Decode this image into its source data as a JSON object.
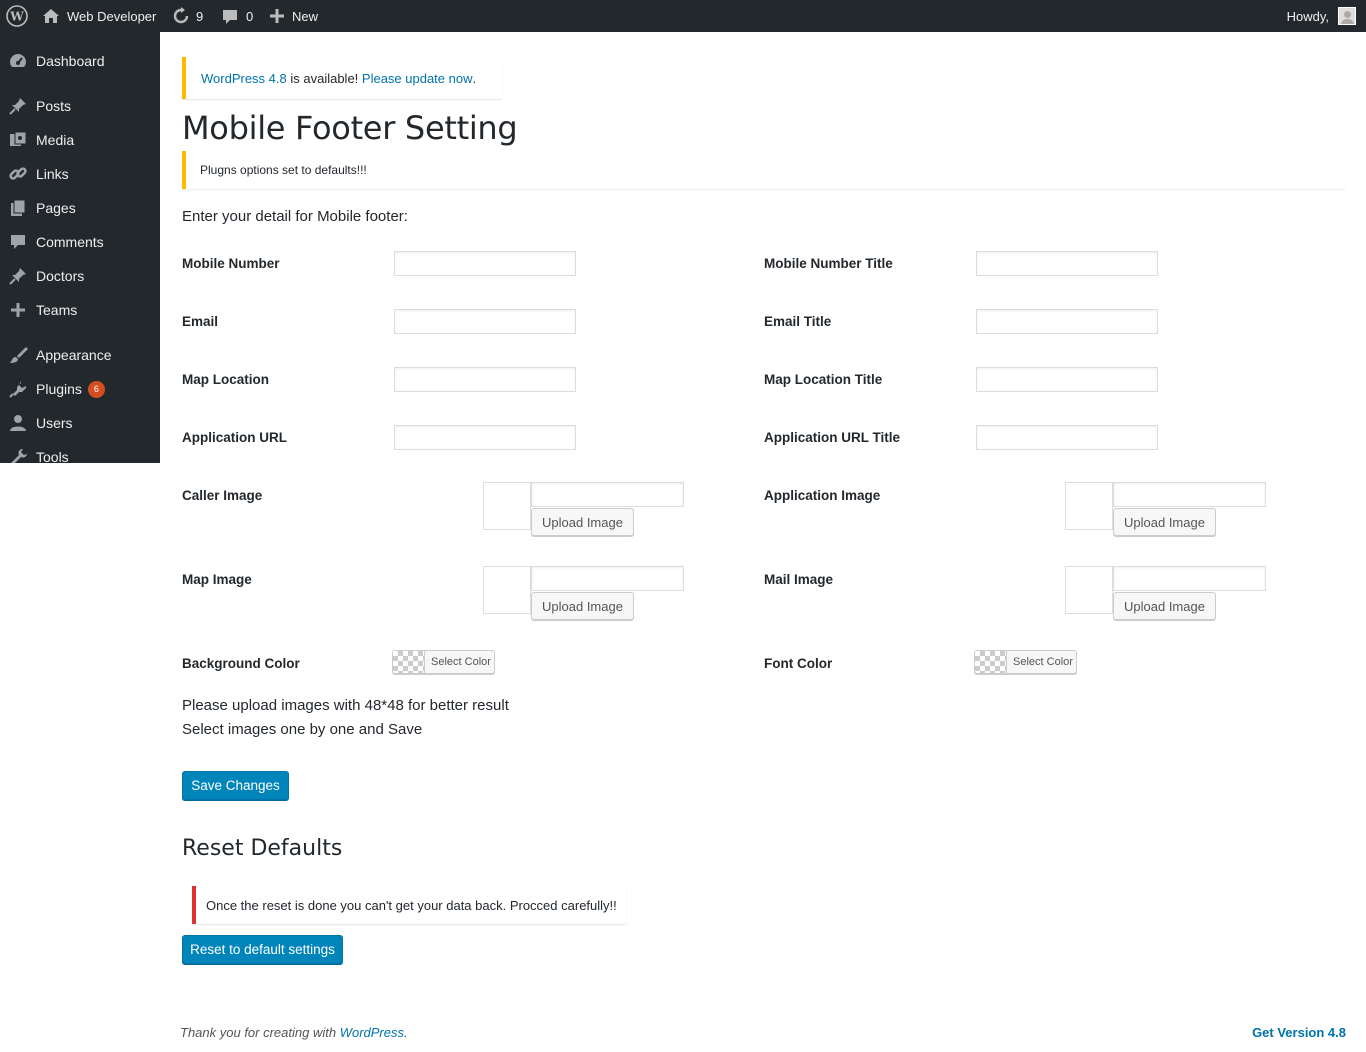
{
  "adminbar": {
    "site_name": "Web Developer",
    "updates_count": "9",
    "comments_count": "0",
    "new_label": "New",
    "howdy": "Howdy,"
  },
  "sidebar": {
    "items": [
      {
        "label": "Dashboard",
        "icon": "dashboard-icon"
      },
      {
        "label": "Posts",
        "icon": "pin-icon"
      },
      {
        "label": "Media",
        "icon": "media-icon"
      },
      {
        "label": "Links",
        "icon": "link-icon"
      },
      {
        "label": "Pages",
        "icon": "pages-icon"
      },
      {
        "label": "Comments",
        "icon": "comment-icon"
      },
      {
        "label": "Doctors",
        "icon": "pin-icon"
      },
      {
        "label": "Teams",
        "icon": "plus-icon"
      },
      {
        "label": "Appearance",
        "icon": "brush-icon"
      },
      {
        "label": "Plugins",
        "icon": "plugin-icon",
        "badge": "6"
      },
      {
        "label": "Users",
        "icon": "user-icon"
      },
      {
        "label": "Tools",
        "icon": "wrench-icon"
      }
    ]
  },
  "update_nag": {
    "version_link": "WordPress 4.8",
    "middle": " is available! ",
    "update_link": "Please update now",
    "end": "."
  },
  "page": {
    "title": "Mobile Footer Setting",
    "notice": "Plugns options set to defaults!!!",
    "intro": "Enter your detail for Mobile footer:"
  },
  "fields": {
    "mobile_number": "Mobile Number",
    "mobile_number_title": "Mobile Number Title",
    "email": "Email",
    "email_title": "Email Title",
    "map_location": "Map Location",
    "map_location_title": "Map Location Title",
    "application_url": "Application URL",
    "application_url_title": "Application URL Title",
    "caller_image": "Caller Image",
    "application_image": "Application Image",
    "map_image": "Map Image",
    "mail_image": "Mail Image",
    "background_color": "Background Color",
    "font_color": "Font Color",
    "upload_label": "Upload Image",
    "select_color_label": "Select Color"
  },
  "notes": {
    "line1": "Please upload images with 48*48 for better result",
    "line2": "Select images one by one and Save"
  },
  "buttons": {
    "save": "Save Changes",
    "reset": "Reset to default settings"
  },
  "reset": {
    "title": "Reset Defaults",
    "warning": "Once the reset is done you can't get your data back. Procced carefully!!"
  },
  "footer": {
    "thank_you": "Thank you for creating with ",
    "wp_link": "WordPress",
    "period": ".",
    "version": "Get Version 4.8"
  }
}
